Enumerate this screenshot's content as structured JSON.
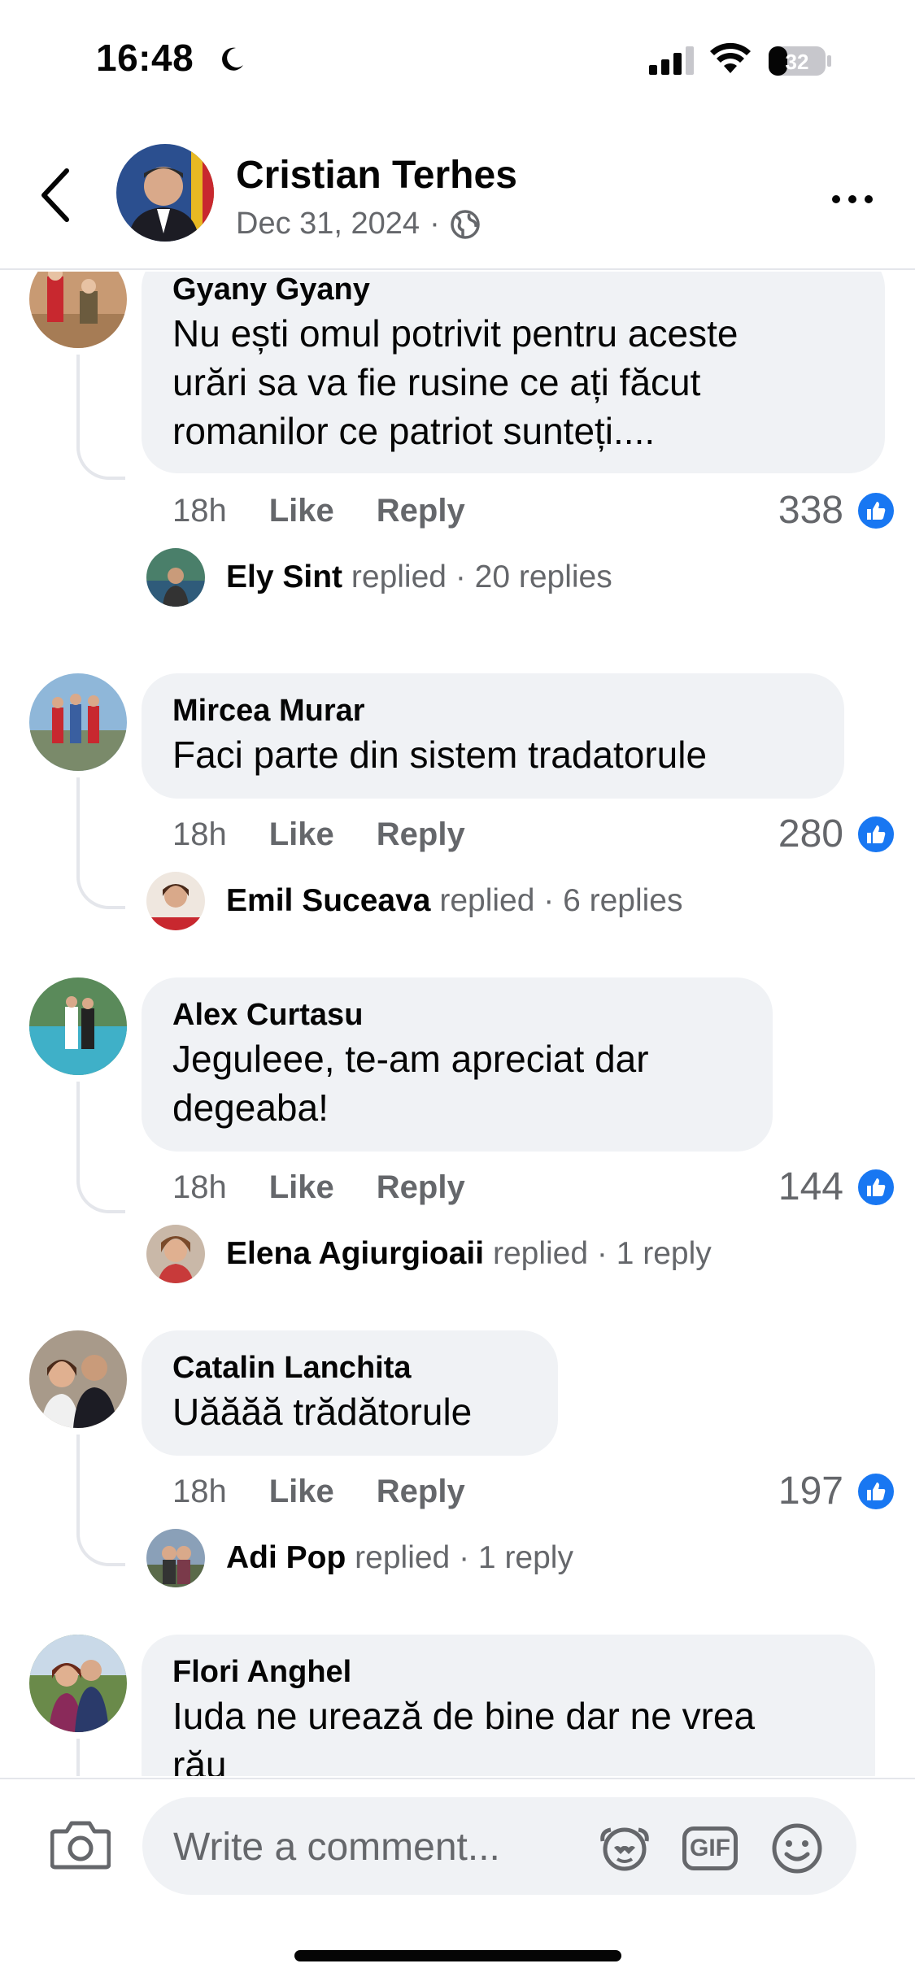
{
  "status_bar": {
    "time": "16:48",
    "battery": "32"
  },
  "header": {
    "name": "Cristian Terhes",
    "date": "Dec 31, 2024",
    "separator": "·"
  },
  "comments": [
    {
      "name": "Gyany Gyany",
      "text": "Nu ești omul potrivit pentru aceste\nurări sa va fie rusine ce ați făcut\nromanilor ce patriot sunteți....",
      "time": "18h",
      "like_label": "Like",
      "reply_label": "Reply",
      "likes": "338",
      "reply": {
        "name": "Ely Sint",
        "verb": "replied",
        "count": "· 20 replies"
      }
    },
    {
      "name": "Mircea Murar",
      "text": "Faci parte din sistem tradatorule",
      "time": "18h",
      "like_label": "Like",
      "reply_label": "Reply",
      "likes": "280",
      "reply": {
        "name": "Emil Suceava",
        "verb": "replied",
        "count": "· 6 replies"
      }
    },
    {
      "name": "Alex Curtasu",
      "text": "Jeguleee, te-am apreciat dar\ndegeaba!",
      "time": "18h",
      "like_label": "Like",
      "reply_label": "Reply",
      "likes": "144",
      "reply": {
        "name": "Elena Agiurgioaii",
        "verb": "replied",
        "count": "· 1 reply"
      }
    },
    {
      "name": "Catalin Lanchita",
      "text": "Uăăăă trădătorule",
      "time": "18h",
      "like_label": "Like",
      "reply_label": "Reply",
      "likes": "197",
      "reply": {
        "name": "Adi Pop",
        "verb": "replied",
        "count": "· 1 reply"
      }
    },
    {
      "name": "Flori Anghel",
      "text": "Iuda ne urează de bine dar ne vrea\nrău"
    }
  ],
  "composer": {
    "placeholder": "Write a comment...",
    "gif_label": "GIF"
  },
  "colors": {
    "accent": "#1877f2",
    "bubble": "#f0f2f5",
    "secondary_text": "#65676b"
  }
}
